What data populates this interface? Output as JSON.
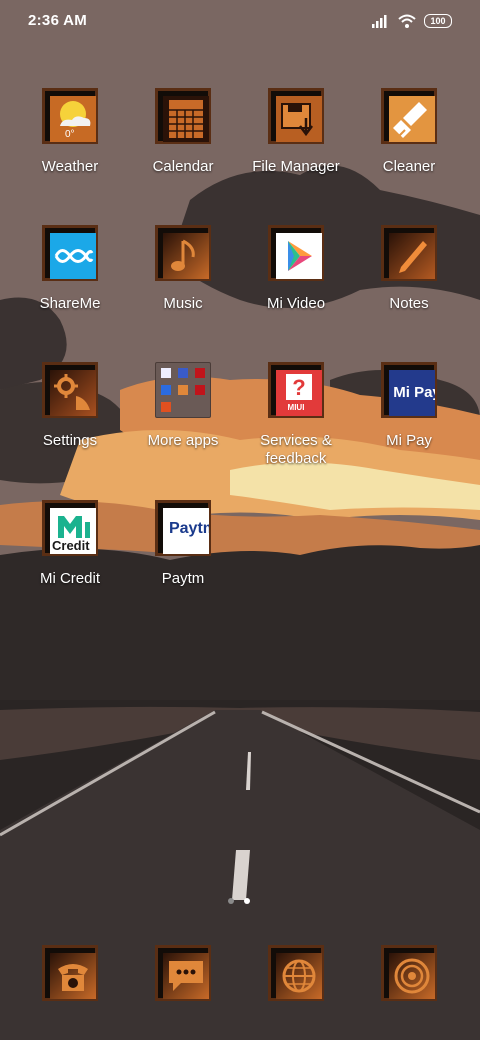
{
  "status_bar": {
    "time": "2:36 AM",
    "battery": "100",
    "icons": [
      "signal-icon",
      "wifi-icon",
      "battery-icon"
    ]
  },
  "apps": [
    {
      "label": "Weather",
      "icon": "weather-icon",
      "badge": "0°"
    },
    {
      "label": "Calendar",
      "icon": "calendar-icon"
    },
    {
      "label": "File Manager",
      "icon": "file-manager-icon"
    },
    {
      "label": "Cleaner",
      "icon": "broom-icon"
    },
    {
      "label": "ShareMe",
      "icon": "shareme-icon"
    },
    {
      "label": "Music",
      "icon": "music-note-icon"
    },
    {
      "label": "Mi Video",
      "icon": "play-icon"
    },
    {
      "label": "Notes",
      "icon": "pencil-icon"
    },
    {
      "label": "Settings",
      "icon": "gear-icon"
    },
    {
      "label": "More apps",
      "icon": "folder-icon"
    },
    {
      "label": "Services & feedback",
      "icon": "miui-help-icon",
      "badge": "MIUI"
    },
    {
      "label": "Mi Pay",
      "icon": "mi-pay-icon",
      "badge": "Mi Pay"
    },
    {
      "label": "Mi Credit",
      "icon": "mi-credit-icon",
      "badge": "Credit"
    },
    {
      "label": "Paytm",
      "icon": "paytm-icon",
      "badge": "Paytm"
    }
  ],
  "dock": [
    {
      "name": "phone",
      "icon": "phone-icon"
    },
    {
      "name": "messages",
      "icon": "message-icon"
    },
    {
      "name": "browser",
      "icon": "globe-icon"
    },
    {
      "name": "camera",
      "icon": "camera-lens-icon"
    }
  ],
  "page_indicator": {
    "pages": 2,
    "current": 2
  },
  "colors": {
    "tile_border": "#5a2e14",
    "tile_orange": "#d9782a",
    "sky": "#7a6661",
    "ground": "#2b2624"
  }
}
